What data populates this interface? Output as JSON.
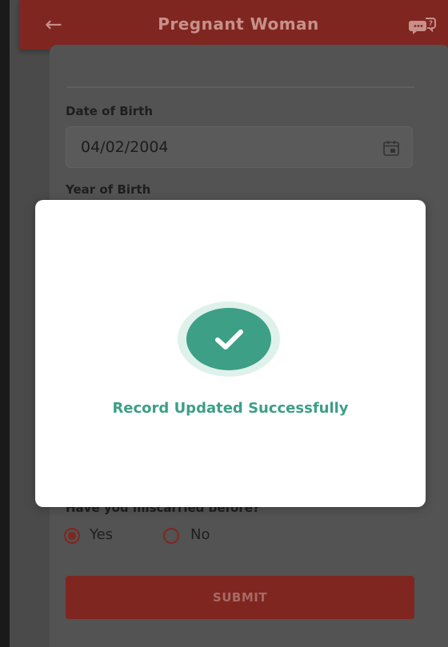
{
  "header": {
    "title": "Pregnant Woman",
    "back_icon": "arrow-left-icon",
    "chat_icon": "chat-help-icon"
  },
  "form": {
    "dob_label": "Date of Birth",
    "dob_value": "04/02/2004",
    "yob_label": "Year of Birth",
    "miscarried_label": "Have you miscarried before?",
    "options": [
      {
        "label": "Yes",
        "selected": true
      },
      {
        "label": "No",
        "selected": false
      }
    ],
    "submit_label": "SUBMIT"
  },
  "dialog": {
    "message": "Record Updated Successfully",
    "icon": "check-circle-icon"
  },
  "colors": {
    "brand": "#7f2620",
    "success": "#3c9f86",
    "success_ring": "#dff1eb"
  }
}
